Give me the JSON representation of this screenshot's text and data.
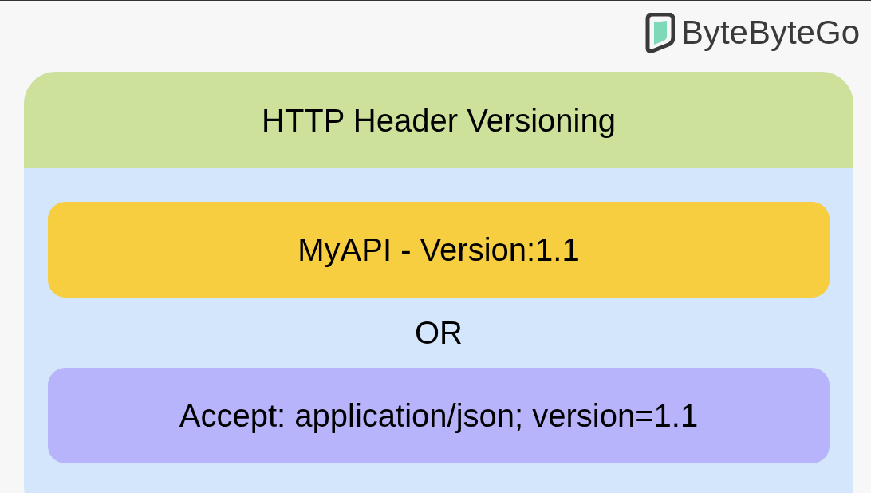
{
  "logo": {
    "text": "ByteByteGo"
  },
  "card": {
    "title": "HTTP Header Versioning",
    "options": [
      {
        "kind": "header",
        "text": "MyAPI - Version:1.1"
      },
      {
        "kind": "separator",
        "text": "OR"
      },
      {
        "kind": "accept",
        "text": "Accept: application/json; version=1.1"
      }
    ]
  }
}
